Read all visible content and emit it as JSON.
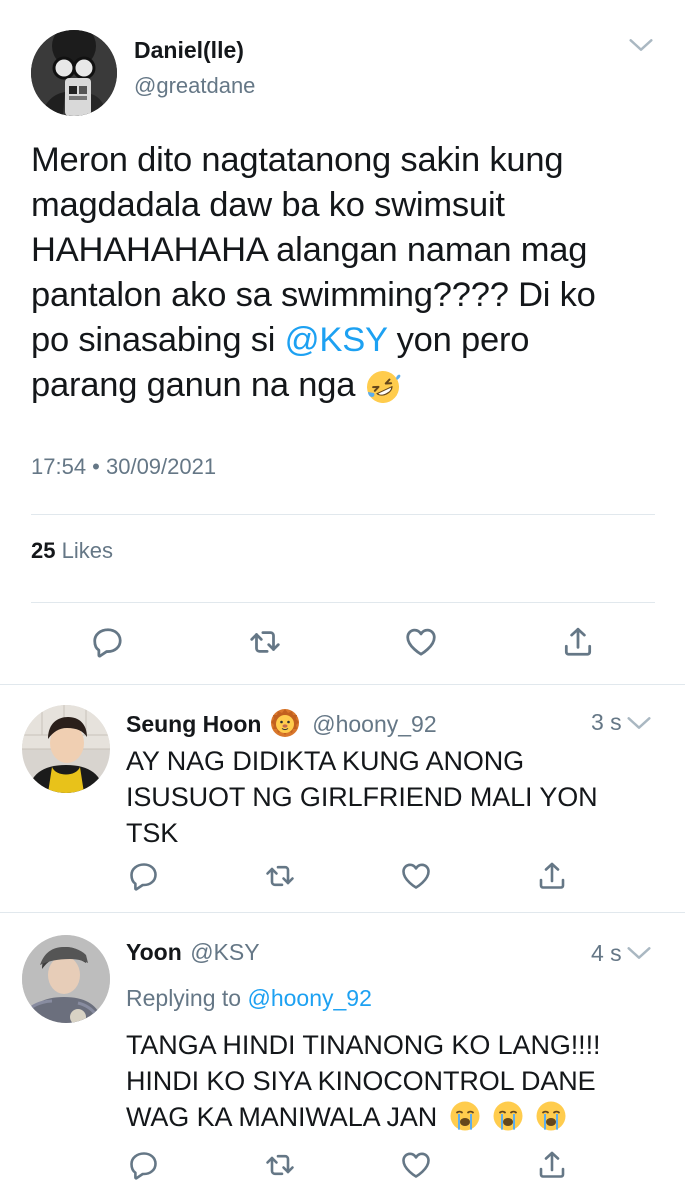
{
  "main_tweet": {
    "display_name": "Daniel(lle)",
    "handle": "@greatdane",
    "text_line1": "Meron dito nagtatanong sakin kung",
    "text_line2": "magdadala daw ba ko swimsuit",
    "text_line3": "HAHAHAHAHA alangan naman mag",
    "text_line4": "pantalon ako sa swimming???? Di ko",
    "text_line5_pre": "po sinasabing si ",
    "text_line5_mention": "@KSY",
    "text_line5_post": " yon pero",
    "text_line6": "parang ganun na nga",
    "timestamp": "17:54 • 30/09/2021",
    "likes_count": "25",
    "likes_label": "Likes"
  },
  "replies": [
    {
      "display_name": "Seung Hoon",
      "handle": "@hoony_92",
      "time": "3 s",
      "line1": "AY NAG DIDIKTA KUNG ANONG",
      "line2": "ISUSUOT NG GIRLFRIEND MALI YON",
      "line3": "TSK"
    },
    {
      "display_name": "Yoon",
      "handle": "@KSY",
      "time": "4 s",
      "replying_label": "Replying to",
      "replying_to": "@hoony_92",
      "line1": "TANGA HINDI TINANONG KO LANG!!!!",
      "line2": "HINDI KO SIYA KINOCONTROL DANE",
      "line3": "WAG KA MANIWALA JAN"
    }
  ],
  "colors": {
    "link": "#1da1f2",
    "secondary": "#657786",
    "divider": "#e1e8ed"
  },
  "icons": [
    "chevron-down-icon",
    "reply-icon",
    "retweet-icon",
    "like-icon",
    "share-icon",
    "lion-emoji",
    "rofl-emoji",
    "crying-emoji"
  ]
}
